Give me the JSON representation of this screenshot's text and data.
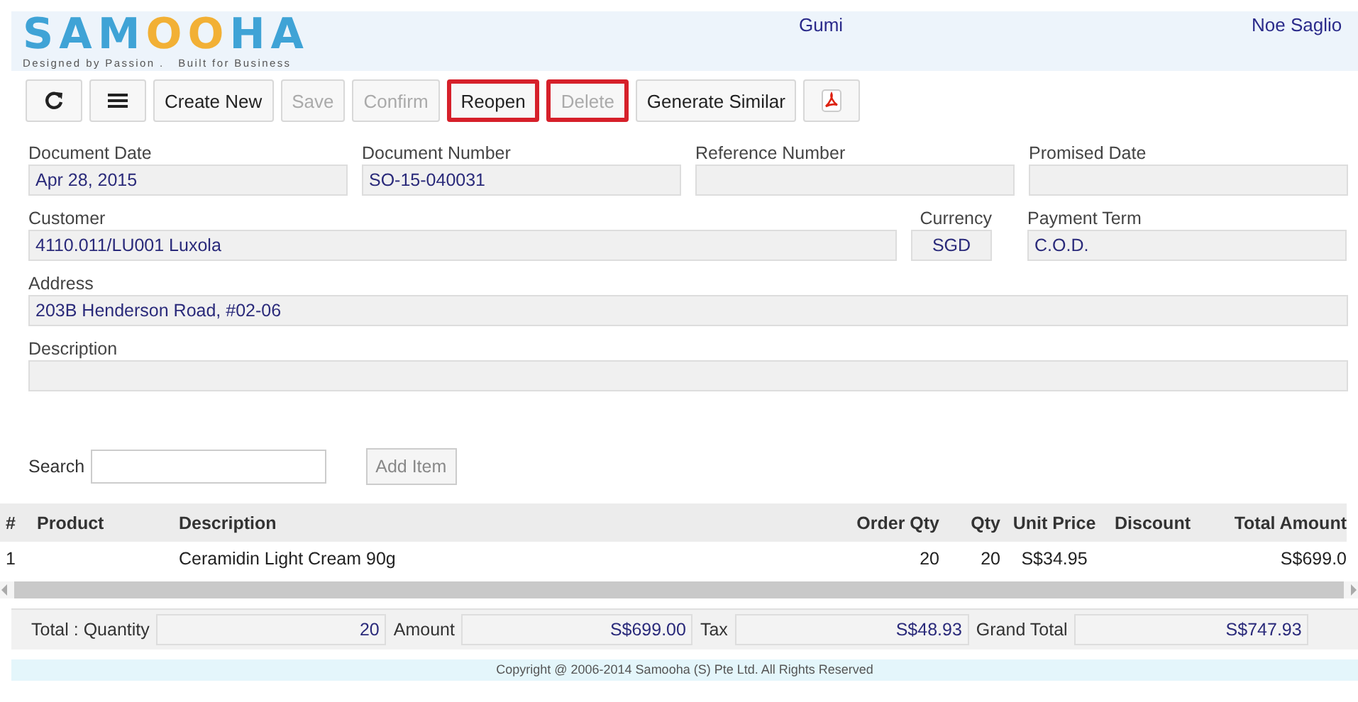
{
  "header": {
    "logo": {
      "left": "SAM",
      "middle": "OO",
      "right": "HA",
      "tagline": "Designed by Passion .   Built for Business"
    },
    "company": "Gumi",
    "user": "Noe Saglio"
  },
  "toolbar": [
    {
      "kind": "refresh"
    },
    {
      "kind": "menu"
    },
    {
      "kind": "text",
      "label": "Create New",
      "disabled": false,
      "highlighted": false
    },
    {
      "kind": "text",
      "label": "Save",
      "disabled": true,
      "highlighted": false
    },
    {
      "kind": "text",
      "label": "Confirm",
      "disabled": true,
      "highlighted": false
    },
    {
      "kind": "text",
      "label": "Reopen",
      "disabled": false,
      "highlighted": true
    },
    {
      "kind": "text",
      "label": "Delete",
      "disabled": true,
      "highlighted": true
    },
    {
      "kind": "text",
      "label": "Generate Similar",
      "disabled": false,
      "highlighted": false
    },
    {
      "kind": "pdf"
    }
  ],
  "form_rows": [
    [
      {
        "label": "Document Date",
        "value": "Apr 28, 2015"
      },
      {
        "label": "Document Number",
        "value": "SO-15-040031"
      },
      {
        "label": "Reference Number"
      },
      {
        "label": "Promised Date"
      }
    ],
    [
      {
        "label": "Customer",
        "value": "4110.011/LU001 Luxola"
      },
      {
        "label": "Currency",
        "value": "SGD"
      },
      {
        "label": "Payment Term",
        "value": "C.O.D."
      }
    ],
    [
      {
        "label": "Address",
        "value": "203B Henderson Road, #02-06"
      }
    ],
    [
      {
        "label": "Description"
      }
    ]
  ],
  "search": {
    "label": "Search",
    "add_button": "Add Item"
  },
  "table": {
    "columns": [
      "#",
      "Product",
      "Description",
      "Order Qty",
      "Qty",
      "Unit Price",
      "Discount",
      "Total Amount"
    ],
    "rows": [
      [
        "1",
        "",
        "Ceramidin Light Cream 90g",
        "20",
        "20",
        "S$34.95",
        "",
        "S$699.0"
      ]
    ]
  },
  "totals": [
    {
      "label": "Total : Quantity",
      "value": "20"
    },
    {
      "label": "Amount",
      "value": "S$699.00"
    },
    {
      "label": "Tax",
      "value": "S$48.93"
    },
    {
      "label": "Grand Total",
      "value": "S$747.93"
    }
  ],
  "footer": "Copyright @ 2006-2014 Samooha (S) Pte Ltd. All Rights Reserved"
}
